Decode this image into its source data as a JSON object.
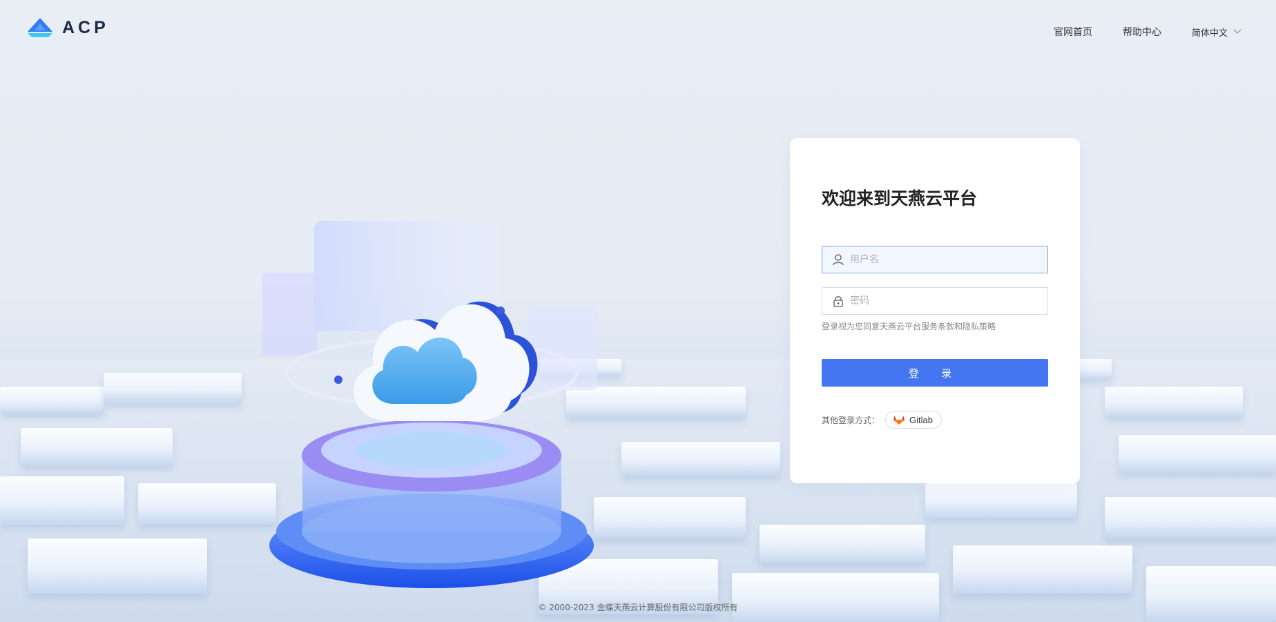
{
  "brand": {
    "name": "ACP"
  },
  "nav": {
    "home": "官网首页",
    "help": "帮助中心",
    "language": "简体中文"
  },
  "login": {
    "title": "欢迎来到天燕云平台",
    "username_placeholder": "用户名",
    "password_placeholder": "密码",
    "agreement": "登录视为您同意天燕云平台服务条款和隐私策略",
    "submit_label": "登 录",
    "other_methods_label": "其他登录方式：",
    "gitlab_label": "Gitlab"
  },
  "footer": {
    "copyright": "© 2000-2023 金蝶天燕云计算股份有限公司版权所有"
  },
  "colors": {
    "accent": "#4476f2",
    "brand_blue": "#2f7cf6",
    "gitlab_orange": "#e24329"
  },
  "icons": {
    "username": "user-icon",
    "password": "lock-icon",
    "language": "chevron-down-icon",
    "gitlab": "gitlab-icon"
  }
}
